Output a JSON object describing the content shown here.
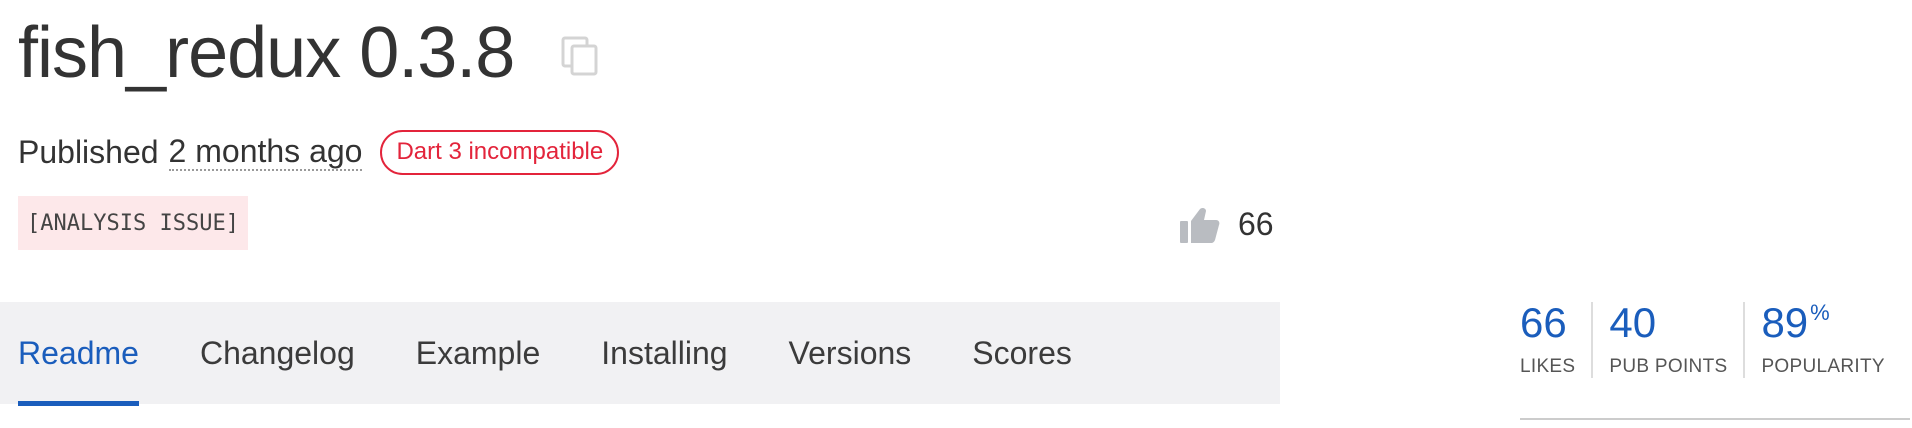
{
  "package": {
    "title": "fish_redux 0.3.8",
    "published_label": "Published",
    "published_ago": "2 months ago",
    "compat_badge": "Dart 3 incompatible",
    "issue_tag": "[ANALYSIS ISSUE]",
    "likes_count": "66"
  },
  "tabs": [
    {
      "label": "Readme",
      "active": true
    },
    {
      "label": "Changelog",
      "active": false
    },
    {
      "label": "Example",
      "active": false
    },
    {
      "label": "Installing",
      "active": false
    },
    {
      "label": "Versions",
      "active": false
    },
    {
      "label": "Scores",
      "active": false
    }
  ],
  "stats": [
    {
      "value": "66",
      "suffix": "",
      "label": "LIKES"
    },
    {
      "value": "40",
      "suffix": "",
      "label": "PUB POINTS"
    },
    {
      "value": "89",
      "suffix": "%",
      "label": "POPULARITY"
    }
  ],
  "icons": {
    "copy": "copy-icon",
    "like": "thumb-up-icon"
  },
  "colors": {
    "accent": "#1a5dbc",
    "incompatible": "#e3243b",
    "issue_bg": "#fde8ea",
    "tabbar_bg": "#f1f1f3"
  }
}
